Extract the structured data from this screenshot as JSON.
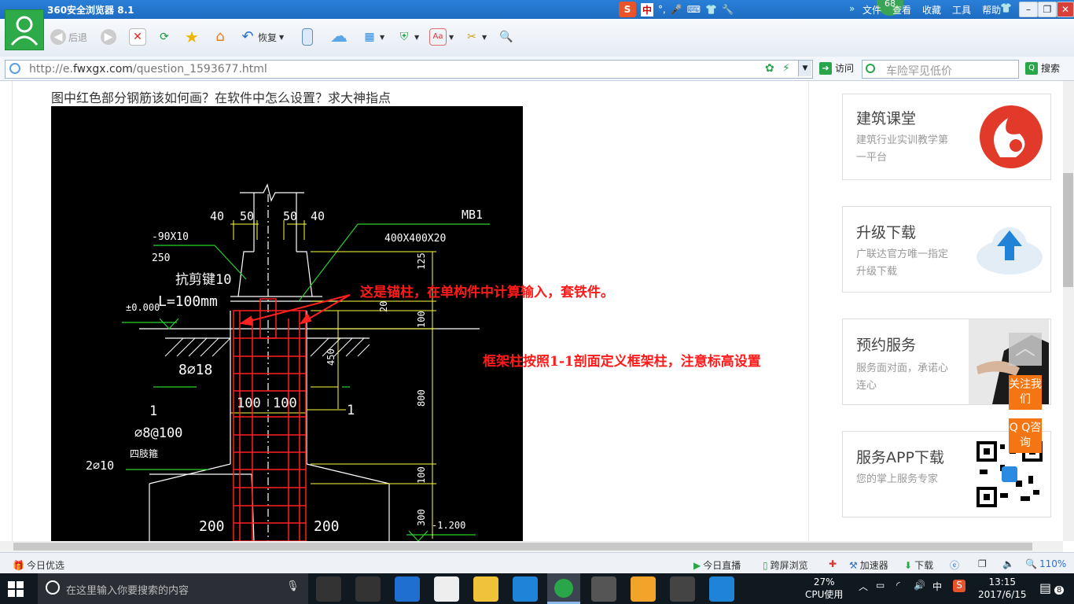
{
  "browser": {
    "title": "360安全浏览器 8.1",
    "badge": "68",
    "title_menu": [
      "文件",
      "查看",
      "收藏",
      "工具",
      "帮助"
    ],
    "ime": {
      "logo": "S",
      "mode": "中"
    },
    "nav": {
      "back": "后退",
      "restore": "恢复"
    },
    "address": {
      "prefix": "http://e.",
      "domain": "fwxgx.com",
      "path": "/question_1593677.html"
    },
    "go_label": "访问",
    "search_placeholder": "车险罕见低价",
    "search_button": "搜索"
  },
  "page": {
    "question": "图中红色部分钢筋该如何画？在软件中怎么设置？求大神指点",
    "drawing": {
      "annotations": [
        "这是锚柱，在单构件中计算输入，套铁件。",
        "框架柱按照1-1剖面定义框架柱，注意标高设置"
      ],
      "dims": {
        "top_left_40": "40",
        "top_left_50": "50",
        "top_right_50": "50",
        "top_right_40": "40",
        "plate_label": "MB1",
        "plate_size": "400X400X20",
        "plate_thickness": "-90X10",
        "plate_250": "250",
        "shear_key": "抗剪键10",
        "shear_len": "L=100mm",
        "elev_0": "±0.000",
        "rebar_main": "8⌀18",
        "w_left_100": "100",
        "w_right_100": "100",
        "section_mark": "1",
        "section_mark_right": "1",
        "stirrup": "⌀8@100",
        "four_legged": "四肢箍",
        "bottom_bar": "2⌀10",
        "base_left_200": "200",
        "base_right_200": "200",
        "d125": "125",
        "d20": "20",
        "d100": "100",
        "d450": "450",
        "d800": "800",
        "d100b": "100",
        "d300": "300",
        "elev_m1200": "-1.200"
      }
    },
    "sidebar": [
      {
        "title": "建筑课堂",
        "sub": "建筑行业实训教学第一平台",
        "icon": "flame-logo-icon"
      },
      {
        "title": "升级下载",
        "sub": "广联达官方唯一指定升级下载",
        "icon": "cloud-upload-icon"
      },
      {
        "title": "预约服务",
        "sub": "服务面对面，承诺心连心",
        "icon": "handshake-icon"
      },
      {
        "title": "服务APP下载",
        "sub": "您的掌上服务专家",
        "icon": "qr-code-icon"
      }
    ],
    "float_buttons": {
      "follow": "关注我们",
      "qq": "Q Q咨询"
    }
  },
  "statusbar": {
    "left": "今日优选",
    "live": "今日直播",
    "cross": "跨屏浏览",
    "accel": "加速器",
    "download": "下载",
    "zoom": "110%"
  },
  "taskbar": {
    "search_placeholder": "在这里输入你要搜索的内容",
    "cpu_percent": "27%",
    "cpu_label": "CPU使用",
    "ime": "中",
    "time": "13:15",
    "date": "2017/6/15",
    "notifications": "8"
  },
  "colors": {
    "titlebar": "#1d6cc2",
    "accent_green": "#2eaa48",
    "orange": "#f57512",
    "cad_red": "#ff2020",
    "cad_yellow": "#ffff40"
  }
}
